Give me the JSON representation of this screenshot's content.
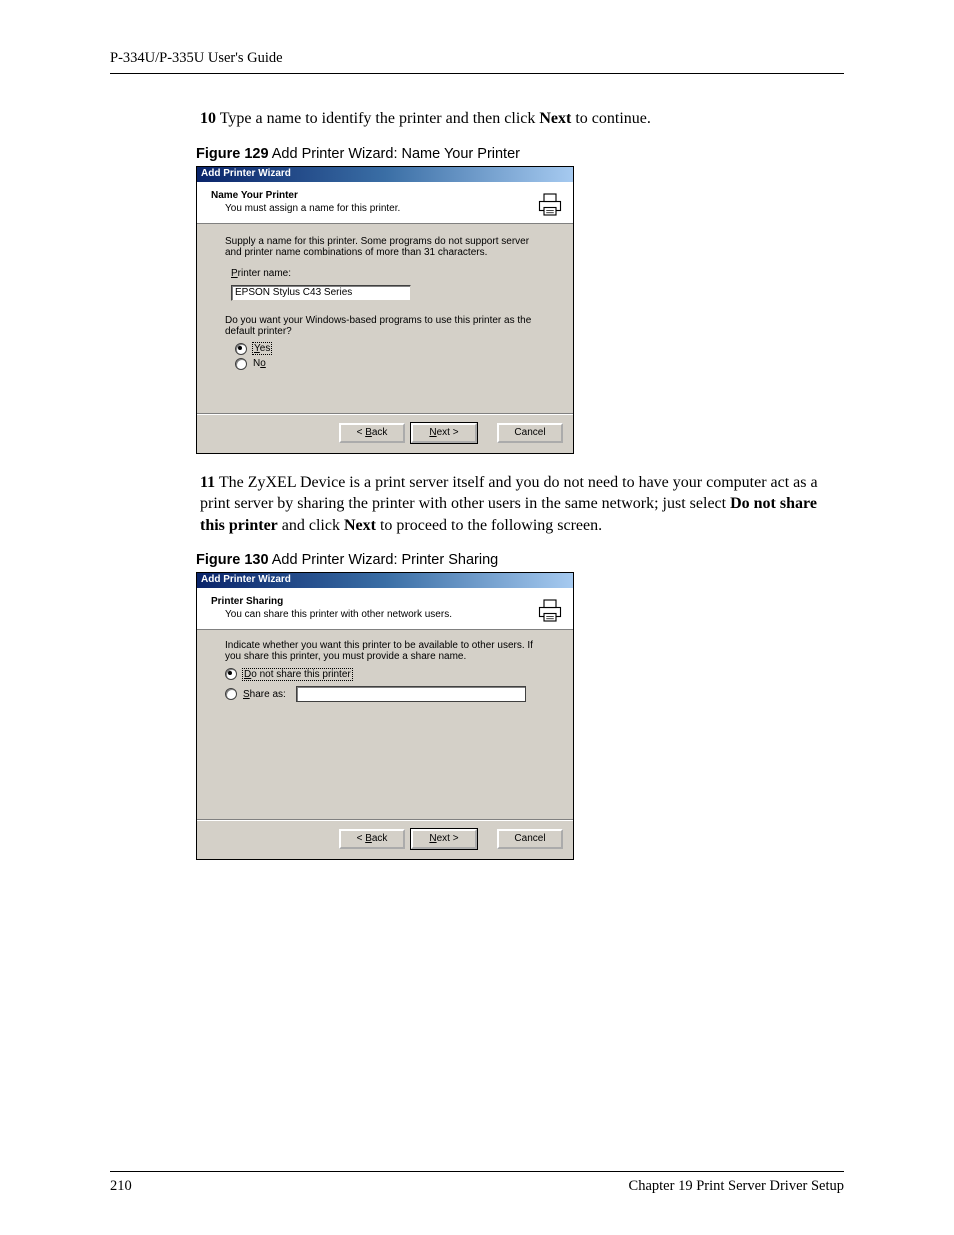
{
  "header": "P-334U/P-335U User's Guide",
  "step10": {
    "num": "10",
    "pre": " Type a name to identify the printer and then click ",
    "bold": "Next",
    "post": " to continue."
  },
  "fig129": {
    "label": "Figure 129",
    "caption": "   Add Printer Wizard: Name Your Printer",
    "title": "Add Printer Wizard",
    "bannerTitle": "Name Your Printer",
    "bannerSub": "You must assign a name for this printer.",
    "supply": "Supply a name for this printer. Some programs do not support server and printer name combinations of more than 31 characters.",
    "pnameLabelP": "P",
    "pnameLabelRest": "rinter name:",
    "pnameValue": "EPSON Stylus C43 Series",
    "defaultQ": "Do you want your Windows-based programs to use this printer as the default printer?",
    "yesY": "Y",
    "yesRest": "es",
    "noN": "N",
    "noO": "o",
    "back1": "< ",
    "backB": "B",
    "backRest": "ack",
    "nextN": "N",
    "nextRest": "ext >",
    "cancel": "Cancel"
  },
  "step11": {
    "num": "11",
    "text1": " The ZyXEL Device is a print server itself and you do not need to have your computer act as a print server by sharing the printer with other users in the same network; just select ",
    "bold1": "Do not share this printer",
    "mid": " and click ",
    "bold2": "Next",
    "post": " to proceed to the following screen."
  },
  "fig130": {
    "label": "Figure 130",
    "caption": "   Add Printer Wizard: Printer Sharing",
    "title": "Add Printer Wizard",
    "bannerTitle": "Printer Sharing",
    "bannerSub": "You can share this printer with other network users.",
    "indicate": "Indicate whether you want this printer to be available to other users. If you share this printer, you must provide a share name.",
    "opt1D": "D",
    "opt1Rest": "o not share this printer",
    "opt2S": "S",
    "opt2Rest": "hare as:",
    "back1": "< ",
    "backB": "B",
    "backRest": "ack",
    "nextN": "N",
    "nextRest": "ext >",
    "cancel": "Cancel"
  },
  "footer": {
    "page": "210",
    "chapter": "Chapter 19 Print Server Driver Setup"
  }
}
